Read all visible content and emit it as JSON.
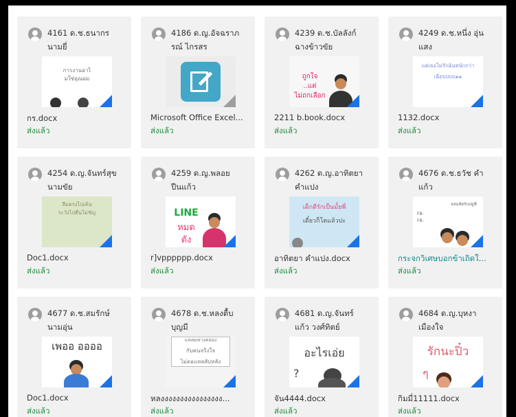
{
  "cards": [
    {
      "name_line1": "4161 ด.ช.ธนากร",
      "name_line2": "นามยี่",
      "file": "กร.docx",
      "status": "ส่งแล้ว",
      "thumb": {
        "lines": [
          "การงานอาไ",
          "มใช่อุณผม"
        ]
      }
    },
    {
      "name_line1": "4186 ด.ญ.อัจฉราภ",
      "name_line2": "รณ์ ไกรสร",
      "file": "Microsoft Office Excel...",
      "status": "ส่งแล้ว",
      "thumb": {
        "icon": "office-lens-icon"
      }
    },
    {
      "name_line1": "4239 ด.ช.บัลลังก์",
      "name_line2": "ฉางข้าวขัย",
      "file": "2211 b.book.docx",
      "status": "ส่งแล้ว",
      "thumb": {
        "lines": [
          "ถูกใจ",
          "..แต่",
          "ไม่ถกเลือก"
        ]
      }
    },
    {
      "name_line1": "4249 ด.ช.หนึ่ง อุ่น",
      "name_line2": "แสง",
      "file": "1132.docx",
      "status": "ส่งแล้ว",
      "thumb": {
        "lines": [
          "แต่เธอไม่รักฉันหนักกว่า",
          "เฉียบบบบ๑๑"
        ]
      }
    },
    {
      "name_line1": "4254 ด.ญ.จันทร์สุข",
      "name_line2": "นามขัย",
      "file": "Doc1.docx",
      "status": "ส่งแล้ว",
      "thumb": {
        "lines": [
          "ลืมตรงไปเค้น",
          "ระวังไปตื่นไม่ชัญ"
        ]
      }
    },
    {
      "name_line1": "4259 ด.ญ.พลอย",
      "name_line2": "ปีนแก้ว",
      "file": "r]vpppppp.docx",
      "status": "ส่งแล้ว",
      "thumb": {
        "lines": [
          "LINE",
          "หมด",
          "ตัง"
        ]
      }
    },
    {
      "name_line1": "4262 ด.ญ.อาทิตยา",
      "name_line2": "คำแปง",
      "file": "อาทิตยา คำแปง.docx",
      "status": "ส่งแล้ว",
      "thumb": {
        "lines": [
          "เด็กดีรักเป็นมั้ยพี่",
          "เดี๋ยวก็โตแล้วปะ"
        ]
      }
    },
    {
      "name_line1": "4676 ด.ช.ธวัช คำ",
      "name_line2": "แก้ว",
      "file": "กระจกวิเศษบอกข้าเถิดใ...",
      "status": "ส่งแล้ว",
      "thumb": {
        "lines": [
          "หล่อสัสกับปยูฟี",
          "FB:",
          "FB:"
        ]
      }
    },
    {
      "name_line1": "4677 ด.ช.สมรักษ์",
      "name_line2": "นามอุ่น",
      "file": "Doc1.docx",
      "status": "ส่งแล้ว",
      "thumb": {
        "lines": [
          "เพออ ออออ"
        ]
      }
    },
    {
      "name_line1": "4678 ด.ช.หลงตื้บ",
      "name_line2": "บุญมี",
      "file": "หลงงงงงงงงงงงงงงงง...",
      "status": "ส่งแล้ว",
      "thumb": {
        "lines": [
          "แหลมทางคลอง",
          "กับคนจริงใจ",
          "ไม่ตอแหลลับหลัง"
        ]
      }
    },
    {
      "name_line1": "4681 ด.ญ.จันทร์",
      "name_line2": "แก้ว วงศ์ทิตย์",
      "file": "จัน4444.docx",
      "status": "ส่งแล้ว",
      "thumb": {
        "lines": [
          "อะไรเอ่ย",
          "?"
        ]
      }
    },
    {
      "name_line1": "4684 ด.ญ.บุหงา",
      "name_line2": "เมืองใจ",
      "file": "กิมมี่11111.docx",
      "status": "ส่งแล้ว",
      "thumb": {
        "lines": [
          "รักนะปิ๋ว",
          "ๆ"
        ]
      }
    }
  ]
}
